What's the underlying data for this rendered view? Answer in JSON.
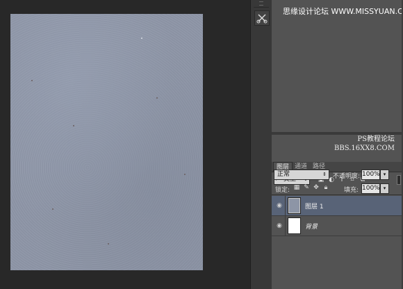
{
  "watermark": {
    "top": "思缘设计论坛 WWW.MISSYUAN.COM",
    "mid_line1": "PS教程论坛",
    "mid_line2": "BBS.16XX8.COM"
  },
  "toolstrip": {
    "tool_icon": "scissors-tools-icon"
  },
  "layers_panel": {
    "tabs": [
      {
        "label": "图层",
        "active": true
      },
      {
        "label": "通道",
        "active": false
      },
      {
        "label": "路径",
        "active": false
      }
    ],
    "menu_icon": "panel-menu-icon",
    "filter": {
      "select_label": "类型",
      "icons": [
        "image-filter-icon",
        "adjustment-filter-icon",
        "type-filter-icon",
        "shape-filter-icon",
        "smart-object-filter-icon"
      ]
    },
    "blend_mode": "正常",
    "opacity_label": "不透明度:",
    "opacity_value": "100%",
    "lock_label": "锁定:",
    "lock_icons": [
      "lock-transparent-icon",
      "lock-image-icon",
      "lock-position-icon",
      "lock-all-icon"
    ],
    "fill_label": "填充:",
    "fill_value": "100%",
    "layers": [
      {
        "name": "图层 1",
        "selected": true,
        "visible": true
      },
      {
        "name": "背景",
        "selected": false,
        "visible": true
      }
    ]
  },
  "colors": {
    "canvas_bg": "#282828",
    "panel_bg": "#535353",
    "selected_layer": "#586377",
    "texture_base": "#8f97a8"
  }
}
